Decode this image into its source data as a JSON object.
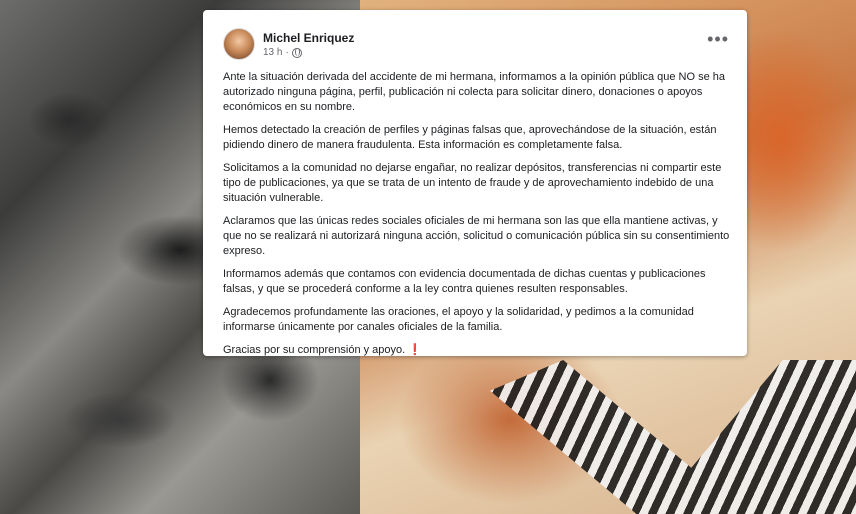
{
  "post": {
    "author": "Michel Enriquez",
    "time": "13 h",
    "separator": "·",
    "more_icon": "more-options-icon",
    "paragraphs": [
      "Ante la situación derivada del accidente de mi hermana, informamos a la opinión pública que NO se ha autorizado ninguna página, perfil, publicación ni colecta para solicitar dinero, donaciones o apoyos económicos en su nombre.",
      "Hemos detectado la creación de perfiles y páginas falsas que, aprovechándose de la situación, están pidiendo dinero de manera fraudulenta. Esta información es completamente falsa.",
      "Solicitamos a la comunidad no dejarse engañar, no realizar depósitos, transferencias ni compartir este tipo de publicaciones, ya que se trata de un intento de fraude y de aprovechamiento indebido de una situación vulnerable.",
      "Aclaramos que las únicas redes sociales oficiales de mi hermana son las que ella mantiene activas, y que no se realizará ni autorizará ninguna acción, solicitud o comunicación pública sin su consentimiento expreso.",
      "Informamos además que contamos con evidencia documentada de dichas cuentas y publicaciones falsas, y que se procederá conforme a la ley contra quienes resulten responsables.",
      "Agradecemos profundamente las oraciones, el apoyo y la solidaridad, y pedimos a la comunidad informarse únicamente por canales oficiales de la familia."
    ],
    "closing": "Gracias por su comprensión y apoyo.",
    "closing_emoji": "❗"
  }
}
